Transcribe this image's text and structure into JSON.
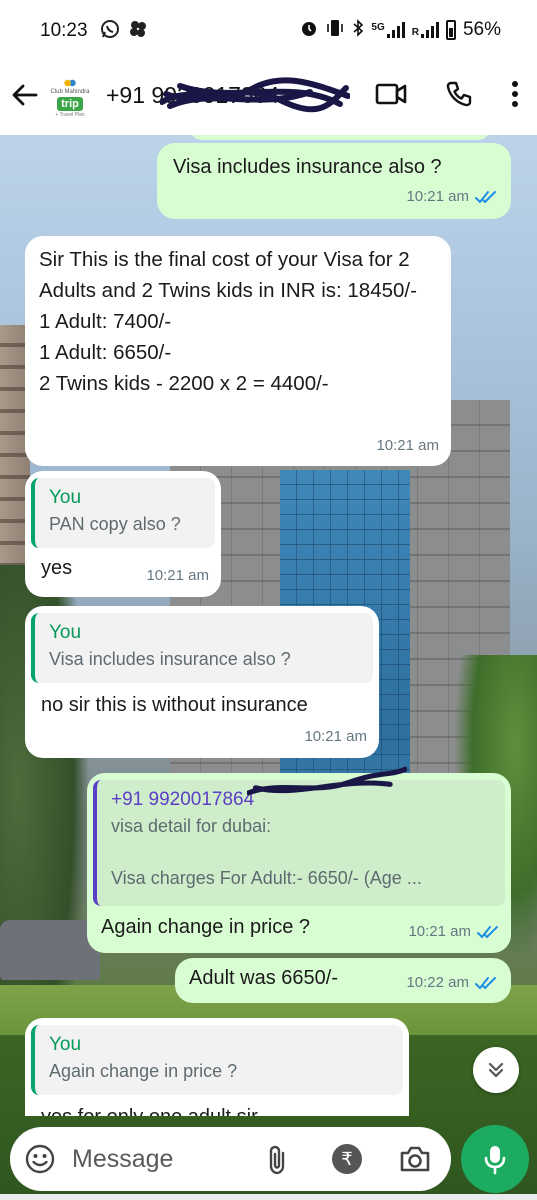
{
  "status_bar": {
    "time": "10:23",
    "network_label": "5G",
    "roaming_label": "R",
    "battery": "56%",
    "app_icons": [
      "whatsapp-icon",
      "clover-icon"
    ],
    "right_icons": [
      "alarm-icon",
      "vibrate-icon",
      "bluetooth-icon",
      "signal-icon",
      "battery-icon"
    ]
  },
  "header": {
    "contact_name": "+91 9920017864",
    "avatar_brand_top": "Club Mahindra",
    "avatar_brand_main": "trip",
    "avatar_brand_sub": "+ Travel Plan",
    "icons": [
      "back-arrow-icon",
      "video-call-icon",
      "phone-call-icon",
      "more-options-icon"
    ]
  },
  "messages": [
    {
      "id": "m1",
      "direction": "out",
      "text": "Visa includes insurance also ?",
      "time": "10:21 am",
      "status": "read"
    },
    {
      "id": "m2",
      "direction": "in",
      "text": "Sir This is the final cost of your Visa for 2 Adults and 2 Twins kids in INR is: 18450/-\n1 Adult: 7400/-\n1 Adult: 6650/-\n2 Twins kids - 2200 x 2 = 4400/-",
      "time": "10:21 am"
    },
    {
      "id": "m3",
      "direction": "in",
      "quote_author": "You",
      "quote_text": "PAN copy also ?",
      "text": "yes",
      "time": "10:21 am"
    },
    {
      "id": "m4",
      "direction": "in",
      "quote_author": "You",
      "quote_text": "Visa includes insurance also ?",
      "text": "no sir this is without insurance",
      "time": "10:21 am"
    },
    {
      "id": "m5",
      "direction": "out",
      "quote_author": "+91 9920017864",
      "quote_text": "visa detail for dubai:\n\nVisa charges For Adult:- 6650/- (Age ...",
      "text": "Again change in price ?",
      "time": "10:21 am",
      "status": "read"
    },
    {
      "id": "m6",
      "direction": "out",
      "text": "Adult was 6650/-",
      "time": "10:22 am",
      "status": "read"
    },
    {
      "id": "m7",
      "direction": "in",
      "quote_author": "You",
      "quote_text": "Again change in price ?",
      "text": "yes for only one adult sir",
      "time": ""
    }
  ],
  "composer": {
    "placeholder": "Message",
    "icons": [
      "emoji-icon",
      "attach-icon",
      "rupee-payment-icon",
      "camera-icon",
      "mic-icon"
    ]
  },
  "colors": {
    "outgoing_bubble": "#d9fdd3",
    "incoming_bubble": "#ffffff",
    "accent_green": "#1daa61",
    "quote_author_you": "#069a5a",
    "quote_author_contact": "#5b3fc4",
    "read_ticks": "#1f8fe6"
  }
}
